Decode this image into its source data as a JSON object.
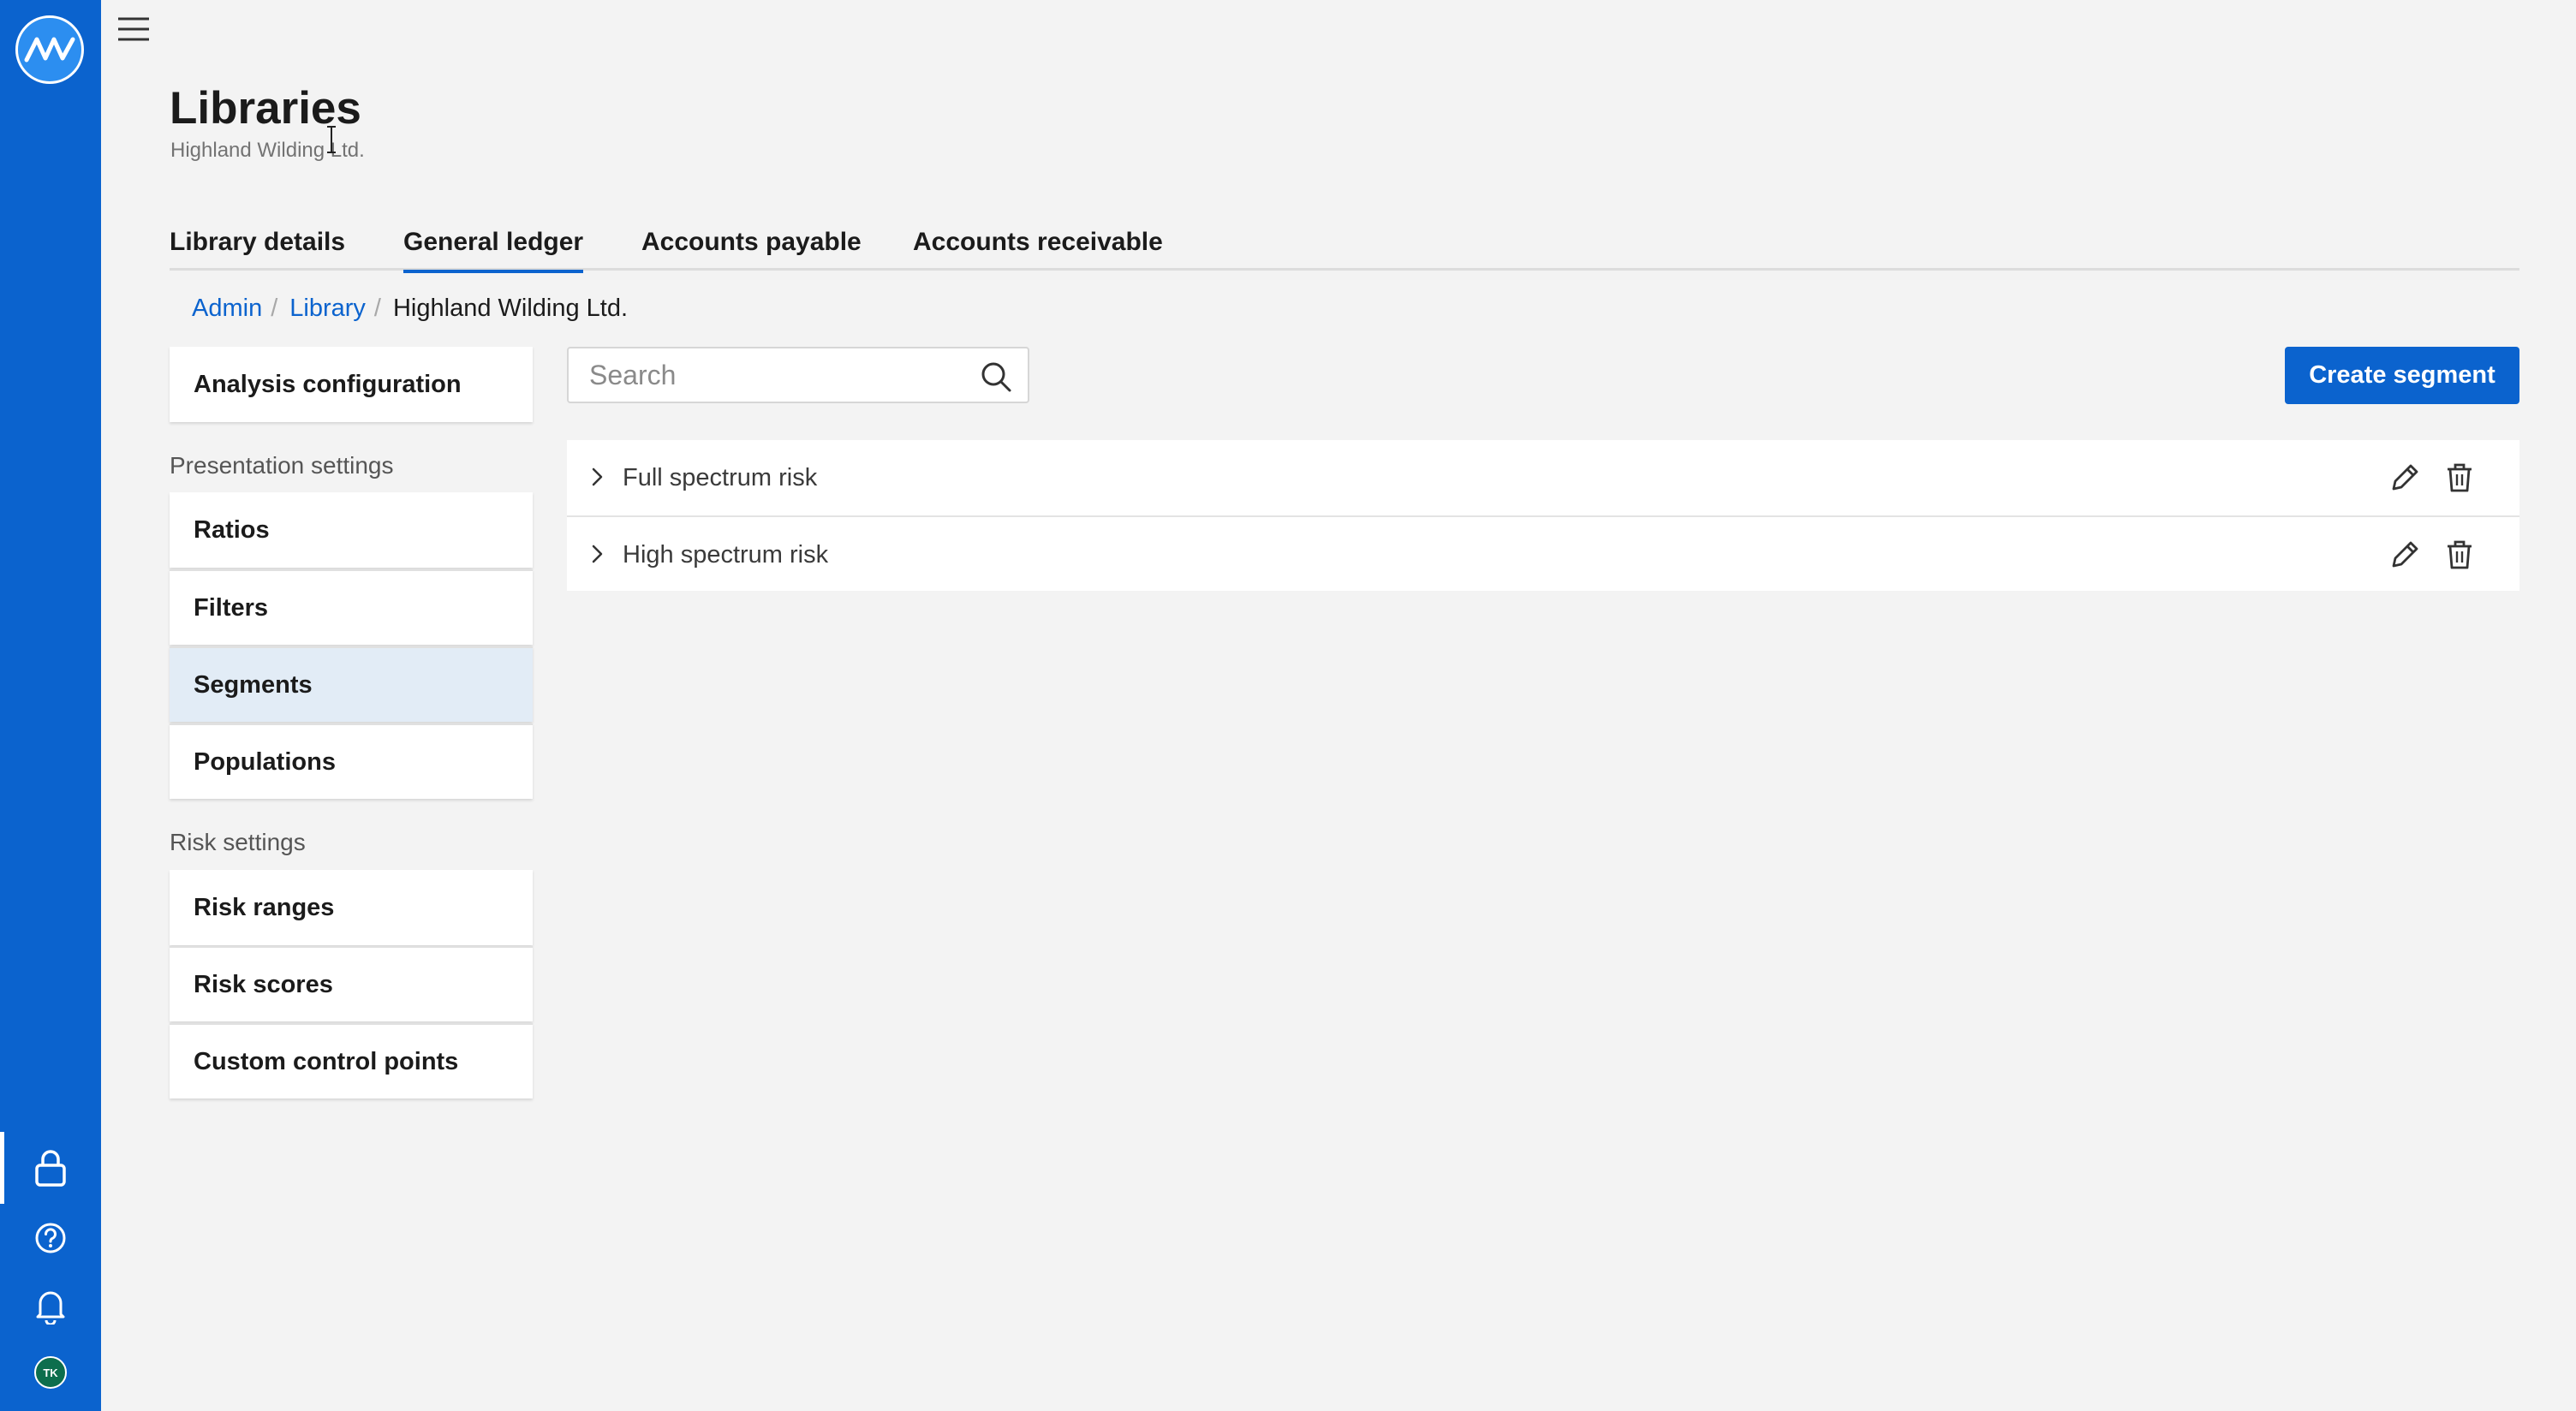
{
  "header": {
    "title": "Libraries",
    "subtitle": "Highland Wilding Ltd."
  },
  "tabs": [
    {
      "label": "Library details",
      "active": false
    },
    {
      "label": "General ledger",
      "active": true
    },
    {
      "label": "Accounts payable",
      "active": false
    },
    {
      "label": "Accounts receivable",
      "active": false
    }
  ],
  "breadcrumb": {
    "items": [
      "Admin",
      "Library"
    ],
    "current": "Highland Wilding Ltd."
  },
  "menu": {
    "top_item": "Analysis configuration",
    "presentation_heading": "Presentation settings",
    "presentation_items": [
      "Ratios",
      "Filters",
      "Segments",
      "Populations"
    ],
    "active_item": "Segments",
    "risk_heading": "Risk settings",
    "risk_items": [
      "Risk ranges",
      "Risk scores",
      "Custom control points"
    ]
  },
  "search": {
    "placeholder": "Search",
    "value": ""
  },
  "toolbar": {
    "create_label": "Create segment"
  },
  "segments": [
    {
      "name": "Full spectrum risk"
    },
    {
      "name": "High spectrum risk"
    }
  ],
  "rail": {
    "icons": [
      "app-logo-icon",
      "lock-icon",
      "help-icon",
      "bell-icon"
    ],
    "avatar_initials": "TK"
  },
  "colors": {
    "primary": "#0b63ce",
    "background": "#f3f3f3",
    "active_menu": "#e2ecf6",
    "avatar": "#0d6e4d"
  }
}
